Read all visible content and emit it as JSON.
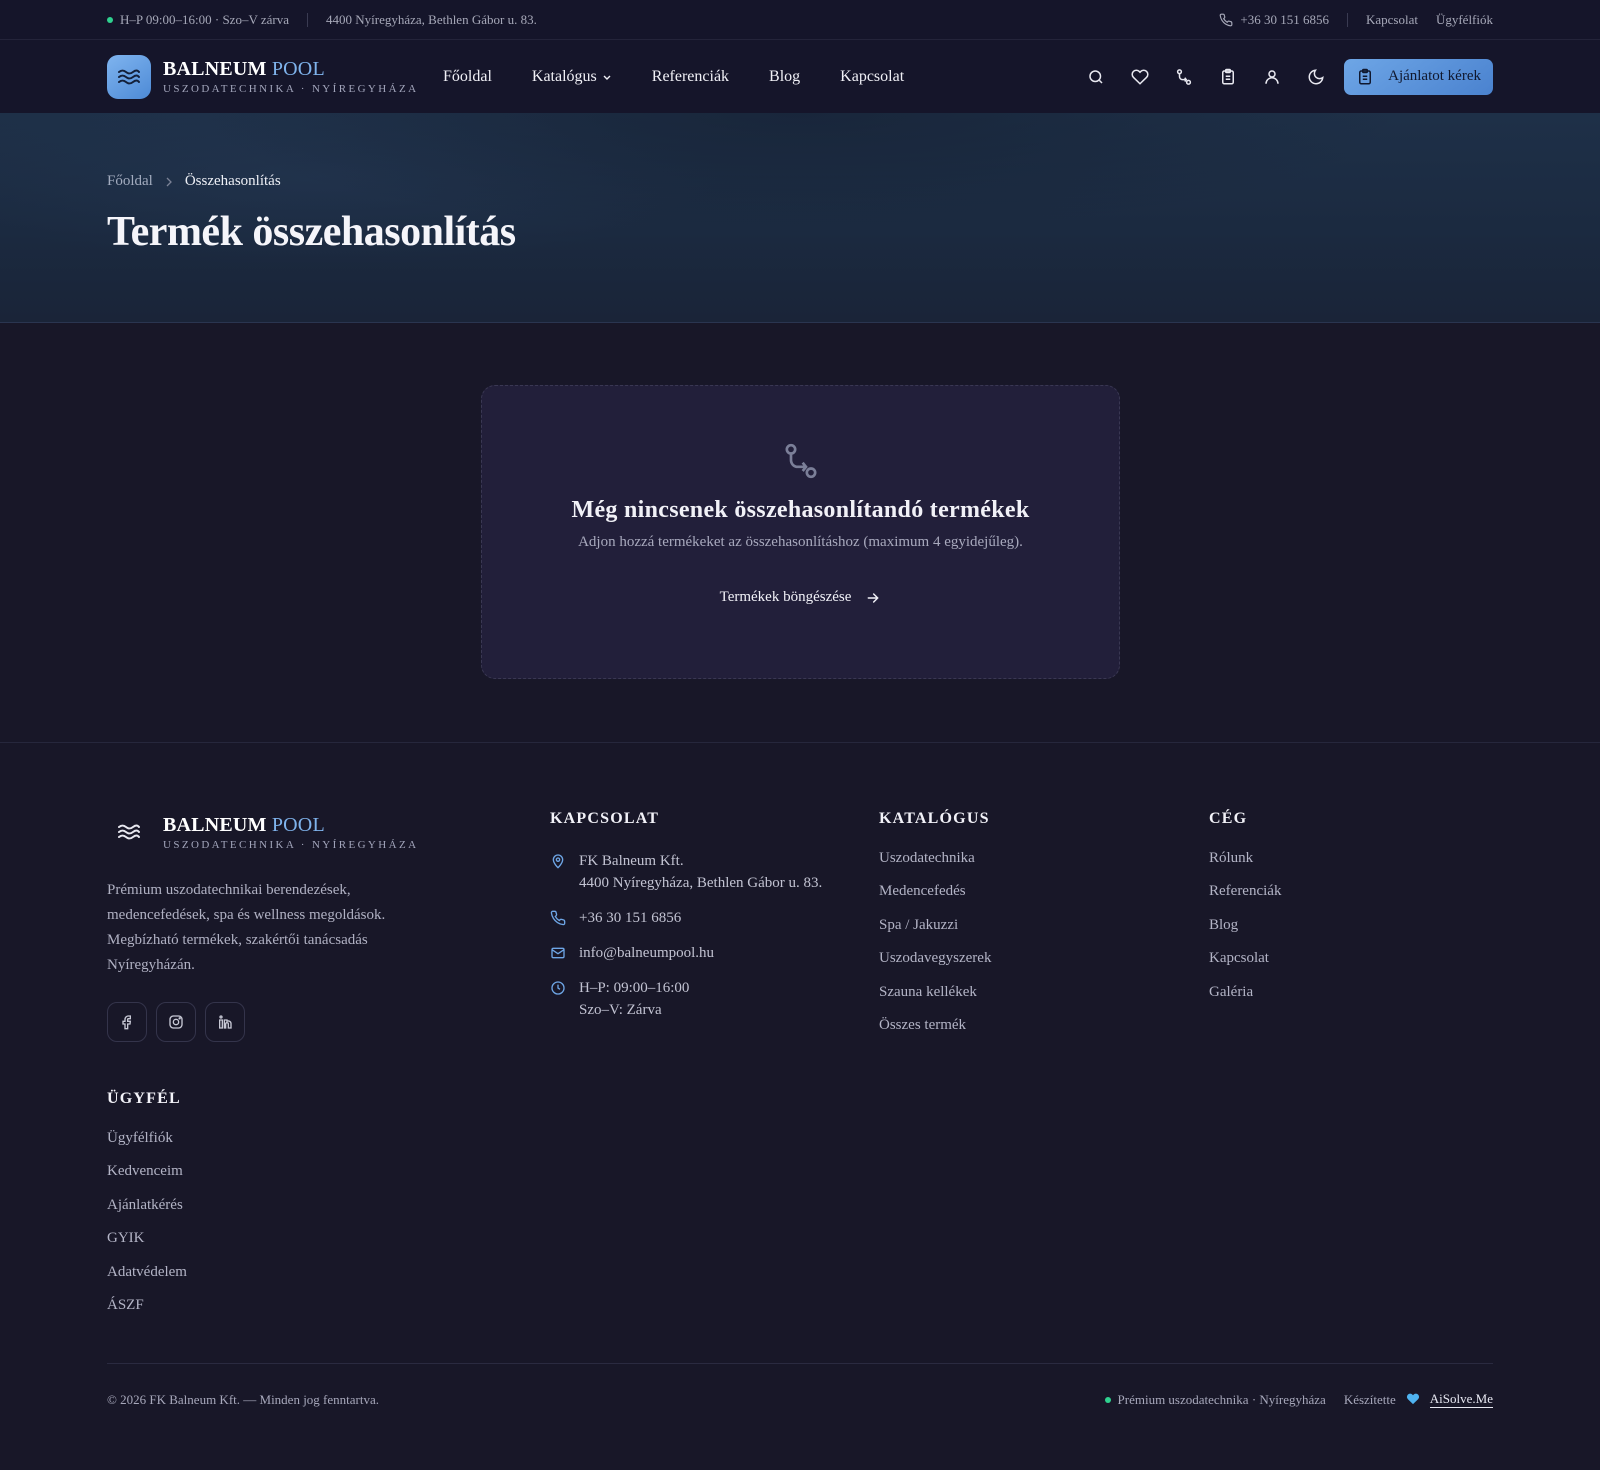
{
  "topbar": {
    "hours": "H–P 09:00–16:00 · Szo–V zárva",
    "address": "4400 Nyíregyháza, Bethlen Gábor u. 83.",
    "phone": "+36 30 151 6856",
    "contact_link": "Kapcsolat",
    "account_link": "Ügyfélfiók",
    "status_color": "#2fd18f"
  },
  "header": {
    "brand_main": "BALNEUM",
    "brand_accent": "POOL",
    "tagline": "USZODATECHNIKA · NYÍREGYHÁZA",
    "nav": [
      {
        "label": "Főoldal"
      },
      {
        "label": "Katalógus"
      },
      {
        "label": "Referenciák"
      },
      {
        "label": "Blog"
      },
      {
        "label": "Kapcsolat"
      }
    ],
    "icons": [
      "search-icon",
      "heart-icon",
      "compare-icon",
      "clipboard-icon",
      "user-icon",
      "moon-icon"
    ],
    "quote_button": "Ajánlatot kérek",
    "accent_color": "#6ea6e6"
  },
  "hero": {
    "breadcrumb_home": "Főoldal",
    "breadcrumb_current": "Összehasonlítás",
    "title": "Termék összehasonlítás"
  },
  "empty_state": {
    "title": "Még nincsenek összehasonlítandó termékek",
    "subtitle": "Adjon hozzá termékeket az összehasonlításhoz (maximum 4 egyidejűleg).",
    "browse_label": "Termékek böngészése"
  },
  "footer": {
    "brand_main": "BALNEUM",
    "brand_accent": "POOL",
    "tagline": "USZODATECHNIKA · NYÍREGYHÁZA",
    "description": "Prémium uszodatechnikai berendezések, medencefedések, spa és wellness megoldások. Megbízható termékek, szakértői tanácsadás Nyíregyházán.",
    "contact": {
      "heading": "KAPCSOLAT",
      "company": "FK Balneum Kft.",
      "address": "4400 Nyíregyháza, Bethlen Gábor u. 83.",
      "phone": "+36 30 151 6856",
      "email": "info@balneumpool.hu",
      "hours_weekday": "H–P: 09:00–16:00",
      "hours_weekend": "Szo–V: Zárva"
    },
    "catalog": {
      "heading": "KATALÓGUS",
      "items": [
        "Uszodatechnika",
        "Medencefedés",
        "Spa / Jakuzzi",
        "Uszodavegyszerek",
        "Szauna kellékek",
        "Összes termék"
      ]
    },
    "company": {
      "heading": "CÉG",
      "items": [
        "Rólunk",
        "Referenciák",
        "Blog",
        "Kapcsolat",
        "Galéria"
      ]
    },
    "client": {
      "heading": "ÜGYFÉL",
      "items": [
        "Ügyfélfiók",
        "Kedvenceim",
        "Ajánlatkérés",
        "GYIK",
        "Adatvédelem",
        "ÁSZF"
      ]
    },
    "copyright": "© 2026 FK Balneum Kft. — Minden jog fenntartva.",
    "premium_note": "Prémium uszodatechnika · Nyíregyháza",
    "made_by": "Készítette",
    "made_by_link": "AiSolve.Me"
  }
}
